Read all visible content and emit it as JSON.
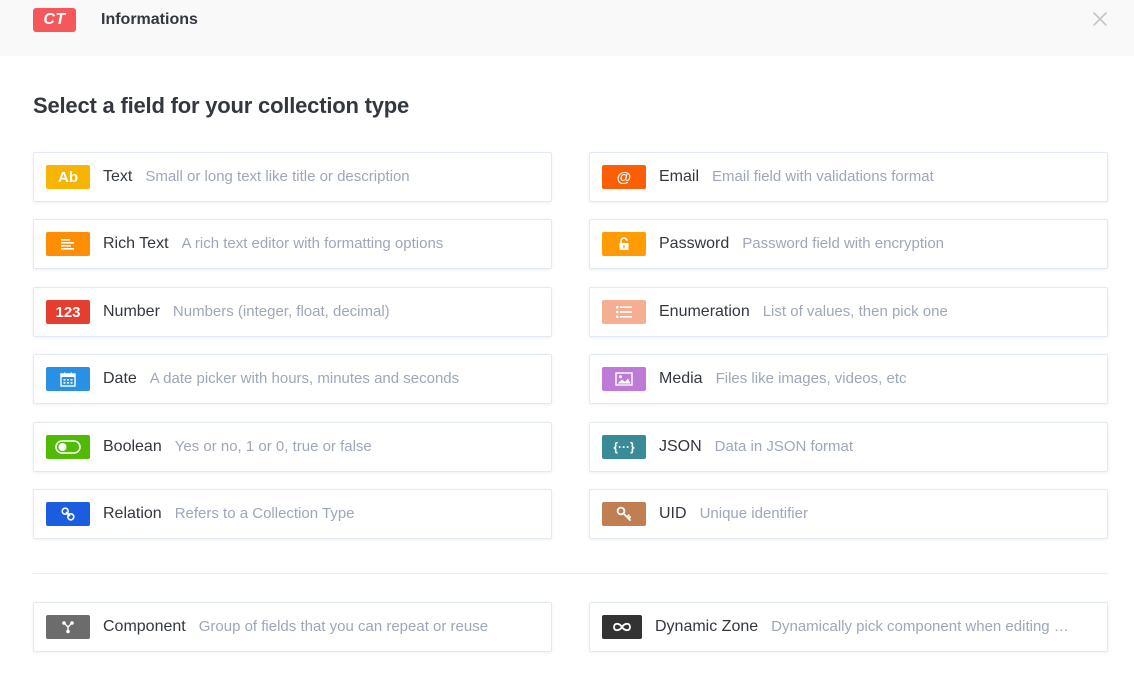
{
  "header": {
    "badge": "CT",
    "title": "Informations"
  },
  "page_title": "Select a field for your collection type",
  "fields": {
    "text": {
      "name": "Text",
      "desc": "Small or long text like title or description",
      "icon_label": "Ab",
      "color": "#f8b403"
    },
    "email": {
      "name": "Email",
      "desc": "Email field with validations format",
      "icon_label": "@",
      "color": "#fa5f05"
    },
    "richtext": {
      "name": "Rich Text",
      "desc": "A rich text editor with formatting options",
      "color": "#fe8e03"
    },
    "password": {
      "name": "Password",
      "desc": "Password field with encryption",
      "color": "#ff9c04"
    },
    "number": {
      "name": "Number",
      "desc": "Numbers (integer, float, decimal)",
      "icon_label": "123",
      "color": "#e53d30"
    },
    "enumeration": {
      "name": "Enumeration",
      "desc": "List of values, then pick one",
      "color": "#f5ae91"
    },
    "date": {
      "name": "Date",
      "desc": "A date picker with hours, minutes and seconds",
      "color": "#2a90e4"
    },
    "media": {
      "name": "Media",
      "desc": "Files like images, videos, etc",
      "color": "#bd7bd7"
    },
    "boolean": {
      "name": "Boolean",
      "desc": "Yes or no, 1 or 0, true or false",
      "color": "#51ba04"
    },
    "json": {
      "name": "JSON",
      "desc": "Data in JSON format",
      "icon_label": "{···}",
      "color": "#3a8b98"
    },
    "relation": {
      "name": "Relation",
      "desc": "Refers to a Collection Type",
      "color": "#1c5de0"
    },
    "uid": {
      "name": "UID",
      "desc": "Unique identifier",
      "color": "#c17e52"
    },
    "component": {
      "name": "Component",
      "desc": "Group of fields that you can repeat or reuse",
      "color": "#6c6c6c"
    },
    "dynamiczone": {
      "name": "Dynamic Zone",
      "desc": "Dynamically pick component when editing …",
      "color": "#333333"
    }
  }
}
